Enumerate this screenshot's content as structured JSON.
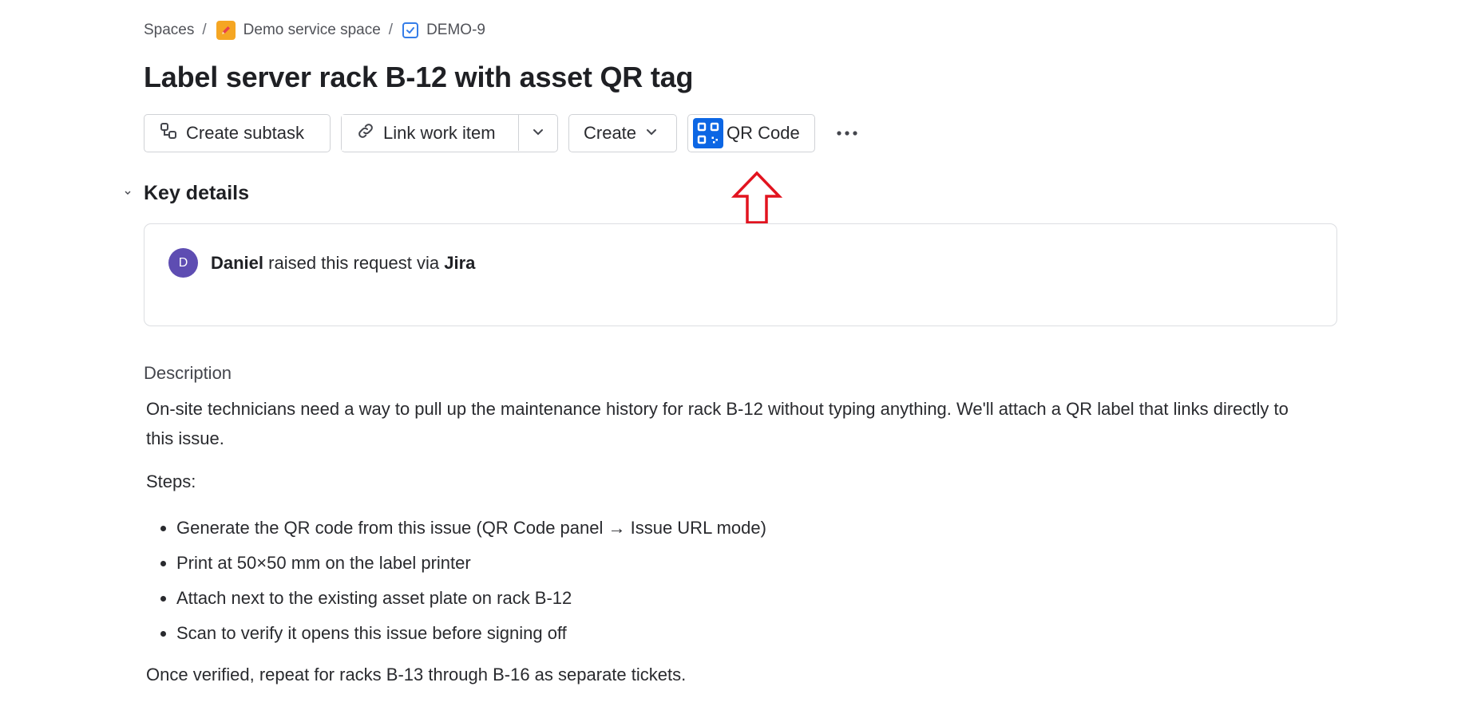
{
  "breadcrumb": {
    "spaces": "Spaces",
    "separator": "/",
    "space": "Demo service space",
    "issue_key": "DEMO-9"
  },
  "issue": {
    "title": "Label server rack B-12 with asset QR tag"
  },
  "toolbar": {
    "create_subtask": "Create subtask",
    "link_work_item": "Link work item",
    "create": "Create",
    "qr_code": "QR Code"
  },
  "key_details": {
    "heading": "Key details",
    "avatar_initial": "D",
    "requester": "Daniel",
    "raised_text": " raised this request via ",
    "channel": "Jira"
  },
  "description": {
    "label": "Description",
    "intro": "On-site technicians need a way to pull up the maintenance history for rack B-12 without typing anything. We'll attach a QR label that links directly to this issue.",
    "steps_label": "Steps:",
    "steps": [
      "Generate the QR code from this issue (QR Code panel → Issue URL mode)",
      "Print at 50×50 mm on the label printer",
      "Attach next to the existing asset plate on rack B-12",
      "Scan to verify it opens this issue before signing off"
    ],
    "closing": "Once verified, repeat for racks B-13 through B-16 as separate tickets."
  },
  "colors": {
    "qr_icon_bg": "#0c66e4",
    "avatar_bg": "#5e4db2",
    "annotation_arrow": "#e2131f",
    "space_icon": "#f5a623"
  }
}
